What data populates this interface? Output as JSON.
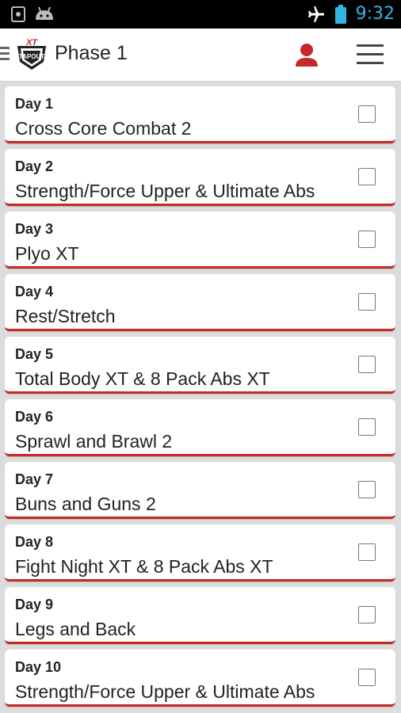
{
  "status_bar": {
    "time": "9:32",
    "icons": [
      "screenshot-icon",
      "android-icon",
      "airplane-icon",
      "battery-icon"
    ],
    "accent": "#33b5e5"
  },
  "app_bar": {
    "logo_text": "TAPOUT XT",
    "title": "Phase 1",
    "icons": [
      "profile-icon",
      "menu-icon"
    ],
    "accent": "#c62828"
  },
  "days": [
    {
      "label": "Day 1",
      "workout": "Cross Core Combat 2",
      "checked": false
    },
    {
      "label": "Day 2",
      "workout": "Strength/Force Upper & Ultimate Abs",
      "checked": false
    },
    {
      "label": "Day 3",
      "workout": "Plyo XT",
      "checked": false
    },
    {
      "label": "Day 4",
      "workout": "Rest/Stretch",
      "checked": false
    },
    {
      "label": "Day 5",
      "workout": "Total Body XT & 8 Pack Abs XT",
      "checked": false
    },
    {
      "label": "Day 6",
      "workout": "Sprawl and Brawl 2",
      "checked": false
    },
    {
      "label": "Day 7",
      "workout": "Buns and Guns 2",
      "checked": false
    },
    {
      "label": "Day 8",
      "workout": "Fight Night XT & 8 Pack Abs XT",
      "checked": false
    },
    {
      "label": "Day 9",
      "workout": "Legs and Back",
      "checked": false
    },
    {
      "label": "Day 10",
      "workout": "Strength/Force Upper & Ultimate Abs",
      "checked": false
    }
  ]
}
